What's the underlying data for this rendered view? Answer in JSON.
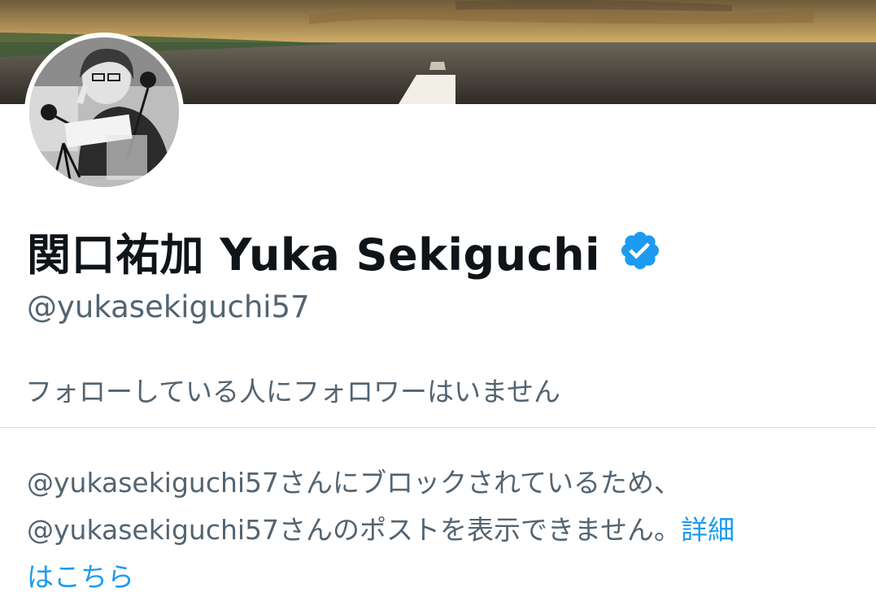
{
  "profile": {
    "display_name": "関口祐加 Yuka Sekiguchi",
    "verified_badge_icon": "verified-badge-icon",
    "handle": "@yukasekiguchi57",
    "follow_context": "フォローしている人にフォロワーはいません"
  },
  "blocked_notice": {
    "line1": "@yukasekiguchi57さんにブロックされているため、",
    "line2": "@yukasekiguchi57さんのポストを表示できません。",
    "learn_more_part1": "詳細",
    "learn_more_part2": "はこちら"
  },
  "colors": {
    "primary_text": "#0f1419",
    "secondary_text": "#536471",
    "link": "#1d9bf0",
    "verified": "#1d9bf0",
    "divider": "#d9dee2"
  }
}
